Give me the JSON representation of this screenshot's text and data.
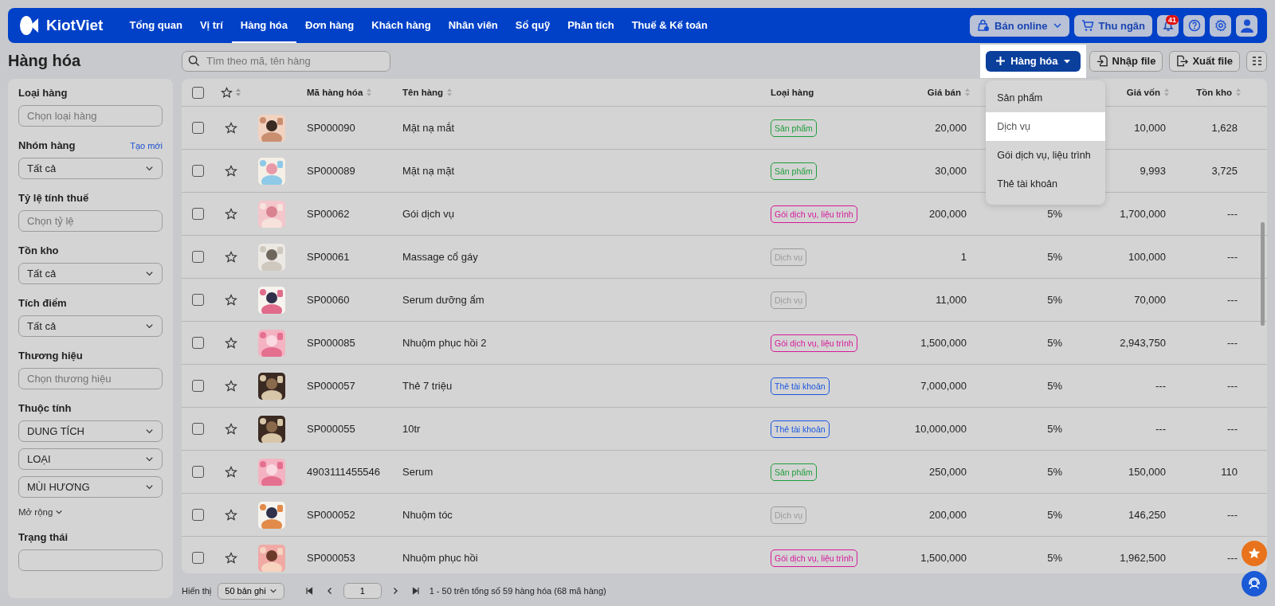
{
  "nav": {
    "logo": "KiotViet",
    "items": [
      {
        "label": "Tổng quan",
        "selected": false
      },
      {
        "label": "Vị trí",
        "selected": false
      },
      {
        "label": "Hàng hóa",
        "selected": true
      },
      {
        "label": "Đơn hàng",
        "selected": false
      },
      {
        "label": "Khách hàng",
        "selected": false
      },
      {
        "label": "Nhân viên",
        "selected": false
      },
      {
        "label": "Sổ quỹ",
        "selected": false
      },
      {
        "label": "Phân tích",
        "selected": false
      },
      {
        "label": "Thuế & Kế toán",
        "selected": false
      }
    ],
    "online_button": "Bán online",
    "cashier_button": "Thu ngân",
    "notification_count": "41"
  },
  "page_title": "Hàng hóa",
  "search": {
    "placeholder": "Tìm theo mã, tên hàng"
  },
  "toolbar": {
    "add_button": "Hàng hóa",
    "import_button": "Nhập file",
    "export_button": "Xuất file"
  },
  "add_menu": [
    {
      "label": "Sản phẩm",
      "selected": false
    },
    {
      "label": "Dịch vụ",
      "selected": true
    },
    {
      "label": "Gói dịch vụ, liệu trình",
      "selected": false
    },
    {
      "label": "Thẻ tài khoản",
      "selected": false
    }
  ],
  "filters": [
    {
      "label": "Loại hàng",
      "kind": "input",
      "placeholder": "Chọn loại hàng"
    },
    {
      "label": "Nhóm hàng",
      "kind": "select",
      "link": "Tạo mới",
      "values": [
        "Tất cả"
      ]
    },
    {
      "label": "Tỷ lệ tính thuế",
      "kind": "input",
      "placeholder": "Chọn tỷ lệ"
    },
    {
      "label": "Tồn kho",
      "kind": "select",
      "values": [
        "Tất cả"
      ]
    },
    {
      "label": "Tích điểm",
      "kind": "select",
      "values": [
        "Tất cả"
      ]
    },
    {
      "label": "Thương hiệu",
      "kind": "input",
      "placeholder": "Chọn thương hiệu"
    },
    {
      "label": "Thuộc tính",
      "kind": "select",
      "values": [
        "DUNG TÍCH",
        "LOẠI",
        "MÙI HƯƠNG"
      ],
      "more": "Mở rộng"
    },
    {
      "label": "Trạng thái",
      "kind": "select"
    }
  ],
  "table": {
    "all_checked": false,
    "columns": [
      "Mã hàng hóa",
      "Tên hàng",
      "Loại hàng",
      "Giá bán",
      "Giá vốn",
      "Tồn kho"
    ],
    "rows": [
      {
        "checked": false,
        "starred": false,
        "code": "SP000090",
        "name": "Mặt nạ mắt",
        "type": "Sản phẩm",
        "color": "#1f9d3a",
        "price": "20,000",
        "cost": "10,000",
        "stock": "1,628"
      },
      {
        "checked": false,
        "starred": false,
        "code": "SP000089",
        "name": "Mặt nạ mặt",
        "type": "Sản phẩm",
        "color": "#1f9d3a",
        "price": "30,000",
        "cost": "9,993",
        "stock": "3,725"
      },
      {
        "checked": false,
        "starred": false,
        "code": "SP00062",
        "name": "Gói dịch vụ",
        "type": "Gói dịch vụ, liệu trình",
        "color": "#d6189a",
        "price": "200,000",
        "tax": "5%",
        "cost": "1,700,000",
        "stock": "---"
      },
      {
        "checked": false,
        "starred": false,
        "code": "SP00061",
        "name": "Massage cổ gáy",
        "type": "Dịch vụ",
        "color": "#9a9a9a",
        "price": "1",
        "tax": "5%",
        "cost": "100,000",
        "stock": "---"
      },
      {
        "checked": false,
        "starred": false,
        "code": "SP00060",
        "name": "Serum dưỡng ẩm",
        "type": "Dịch vụ",
        "color": "#9a9a9a",
        "price": "11,000",
        "tax": "5%",
        "cost": "70,000",
        "stock": "---"
      },
      {
        "checked": false,
        "starred": false,
        "code": "SP000085",
        "name": "Nhuộm phục hồi 2",
        "type": "Gói dịch vụ, liệu trình",
        "color": "#d6189a",
        "price": "1,500,000",
        "tax": "5%",
        "cost": "2,943,750",
        "stock": "---"
      },
      {
        "checked": false,
        "starred": false,
        "code": "SP000057",
        "name": "Thẻ 7 triệu",
        "type": "Thẻ tài khoản",
        "color": "#1a56e0",
        "price": "7,000,000",
        "tax": "5%",
        "cost": "---",
        "stock": "---"
      },
      {
        "checked": false,
        "starred": false,
        "code": "SP000055",
        "name": "10tr",
        "type": "Thẻ tài khoản",
        "color": "#1a56e0",
        "price": "10,000,000",
        "tax": "5%",
        "cost": "---",
        "stock": "---"
      },
      {
        "checked": false,
        "starred": false,
        "code": "4903111455546",
        "name": "Serum",
        "type": "Sản phẩm",
        "color": "#1f9d3a",
        "price": "250,000",
        "tax": "5%",
        "cost": "150,000",
        "stock": "110"
      },
      {
        "checked": false,
        "starred": false,
        "code": "SP000052",
        "name": "Nhuộm tóc",
        "type": "Dịch vụ",
        "color": "#9a9a9a",
        "price": "200,000",
        "tax": "5%",
        "cost": "146,250",
        "stock": "---"
      },
      {
        "checked": false,
        "starred": false,
        "code": "SP000053",
        "name": "Nhuộm phục hồi",
        "type": "Gói dịch vụ, liệu trình",
        "color": "#d6189a",
        "price": "1,500,000",
        "tax": "5%",
        "cost": "1,962,500",
        "stock": "---"
      }
    ]
  },
  "pagination": {
    "label": "Hiển thị",
    "page_size": "50 bản ghi",
    "page": "1",
    "summary": "1 - 50 trên tổng số 59 hàng hóa (68 mã hàng)"
  }
}
